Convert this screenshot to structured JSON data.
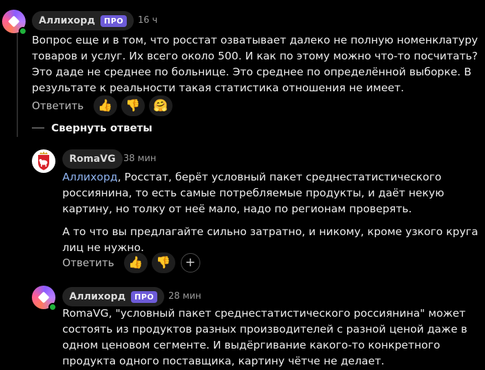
{
  "comments": [
    {
      "author": "Аллихорд",
      "badge": "ПРО",
      "time": "16 ч",
      "text": "Вопрос еще и в том, что росстат озватывает далеко не полную номенклатуру товаров и услуг. Их всего около 500. И как по этому можно что-то посчитать? Это даде не среднее по больнице. Это среднее по определённой выборке. В результате к реальности такая статистика отношения не имеет.",
      "reply_label": "Ответить",
      "reactions": [
        "👍",
        "👎",
        "🤗"
      ]
    },
    {
      "author": "RomaVG",
      "time": "38 мин",
      "mention": "Аллихорд",
      "text_p1": ", Росстат, берёт условный пакет среднестатистического россиянина, то есть самые потребляемые продукты, и даёт некую картину, но толку от неё мало, надо по регионам проверять.",
      "text_p2": "А то что вы предлагайте сильно затратно, и никому, кроме узкого круга лиц не нужно.",
      "reply_label": "Ответить",
      "reactions": [
        "👍",
        "👎",
        "+"
      ]
    },
    {
      "author": "Аллихорд",
      "badge": "ПРО",
      "time": "28 мин",
      "text": "RomaVG, \"условный пакет среднестатистического россиянина\" может состоять из продуктов разных производителей с разной ценой даже в одном ценовом сегменте. И выдёргивание какого-то конкретного продукта одного поставщика, картину чётче не делает."
    }
  ],
  "collapse_label": "Свернуть ответы",
  "colors": {
    "background": "#000000",
    "pill": "#232323",
    "pro_badge": "#6d5bd8",
    "mention": "#8fb4f2",
    "online": "#1fb33b"
  }
}
